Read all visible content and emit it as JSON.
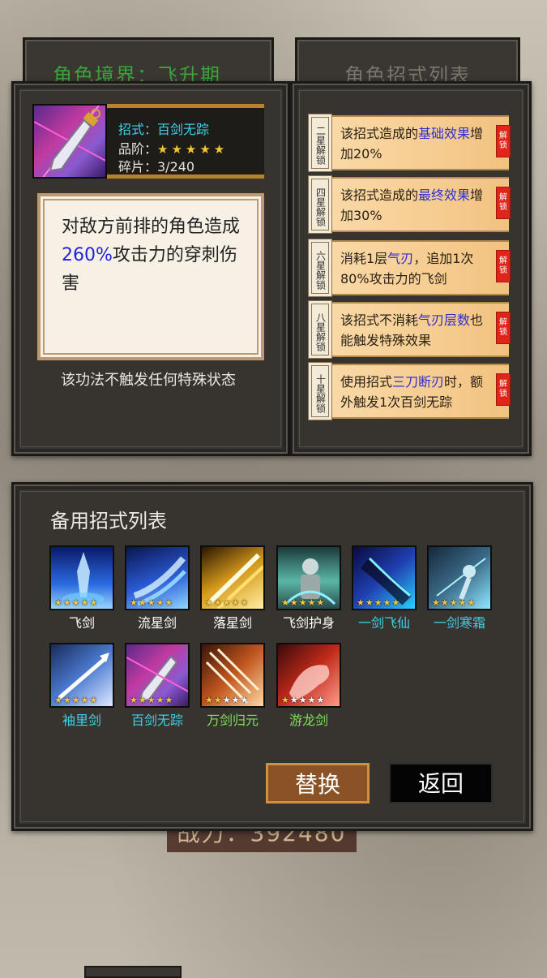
{
  "bg_tabs": {
    "left": "角色境界：飞升期",
    "right": "角色招式列表"
  },
  "skill": {
    "name_line": "招式：百剑无踪",
    "grade_label": "品阶：",
    "grade_stars": "★★★★★",
    "shards_line": "碎片：3/240",
    "icon": "flying-sword-icon",
    "desc_part1": "对敌方前排的角色造成",
    "desc_highlight": "260%",
    "desc_part2": "攻击力的穿刺伤害",
    "note": "该功法不触发任何特殊状态"
  },
  "unlocks": [
    {
      "tag": "二星解锁",
      "pre": "该招式造成的",
      "hl": "基础效果",
      "post": "增加20%",
      "seal": "解锁"
    },
    {
      "tag": "四星解锁",
      "pre": "该招式造成的",
      "hl": "最终效果",
      "post": "增加30%",
      "seal": "解锁"
    },
    {
      "tag": "六星解锁",
      "pre": "消耗1层",
      "hl": "气刃",
      "post": "，追加1次80%攻击力的飞剑",
      "seal": "解锁"
    },
    {
      "tag": "八星解锁",
      "pre": "该招式不消耗",
      "hl": "气刃层数",
      "post": "也能触发特殊效果",
      "seal": "解锁"
    },
    {
      "tag": "十星解锁",
      "pre": "使用招式",
      "hl": "三刀断刃",
      "post": "时，额外触发1次百剑无踪",
      "seal": "解锁"
    }
  ],
  "backup": {
    "title": "备用招式列表",
    "items": [
      {
        "name": "飞剑",
        "icon": "sword-icon",
        "stars": "★★★★★",
        "off": "",
        "color": "#ffffff"
      },
      {
        "name": "流星剑",
        "icon": "meteor-icon",
        "stars": "★★★★★",
        "off": "",
        "color": "#ffffff"
      },
      {
        "name": "落星剑",
        "icon": "star-fall-icon",
        "stars": "★★★★★",
        "off": "",
        "color": "#ffffff"
      },
      {
        "name": "飞剑护身",
        "icon": "guard-icon",
        "stars": "★★★★★",
        "off": "",
        "color": "#ffffff"
      },
      {
        "name": "一剑飞仙",
        "icon": "immortal-sword-icon",
        "stars": "★★★★★",
        "off": "",
        "color": "#3fd0e6"
      },
      {
        "name": "一剑寒霜",
        "icon": "frost-sword-icon",
        "stars": "★★★★★",
        "off": "",
        "color": "#3fd0e6"
      },
      {
        "name": "袖里剑",
        "icon": "sleeve-sword-icon",
        "stars": "★★★★★",
        "off": "",
        "color": "#3fd0e6"
      },
      {
        "name": "百剑无踪",
        "icon": "flying-sword-icon",
        "stars": "★★★★★",
        "off": "",
        "color": "#3fd0e6"
      },
      {
        "name": "万剑归元",
        "icon": "ten-thousand-swords-icon",
        "stars": "★★",
        "off": "★★★",
        "color": "#7ee05a"
      },
      {
        "name": "游龙剑",
        "icon": "dragon-sword-icon",
        "stars": "★",
        "off": "★★★★",
        "color": "#7ee05a"
      }
    ]
  },
  "buttons": {
    "replace": "替换",
    "back": "返回"
  },
  "power_text": "战力：392480"
}
